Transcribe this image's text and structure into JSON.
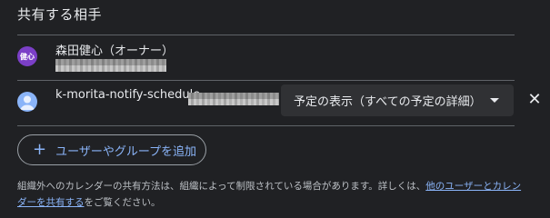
{
  "section": {
    "title": "共有する相手"
  },
  "owner": {
    "avatar_text": "健心",
    "name": "森田健心（オーナー）",
    "avatar_color": "#7b3fc7"
  },
  "shared_user": {
    "avatar_icon": "person-icon",
    "email": "k-morita-notify-schedule",
    "permission": "予定の表示（すべての予定の詳細）",
    "avatar_color": "#8ab4f8"
  },
  "actions": {
    "add_label": "ユーザーやグループを追加",
    "remove_icon": "close-icon"
  },
  "footnote": {
    "text": "組織外へのカレンダーの共有方法は、組織によって制限されている場合があります。詳しくは、",
    "link": "他のユーザーとカレンダーを共有する",
    "suffix": "をご覧ください。"
  },
  "colors": {
    "background": "#202124",
    "link": "#8ab4f8",
    "text": "#e8eaed"
  }
}
